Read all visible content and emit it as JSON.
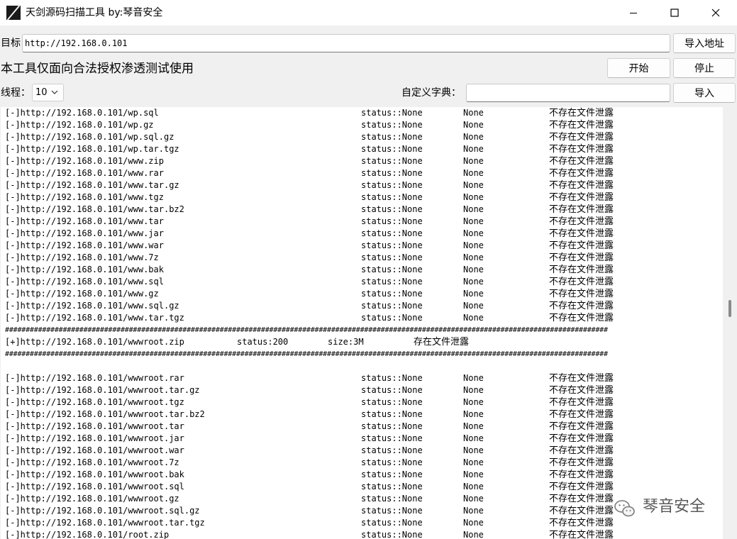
{
  "window": {
    "title": "天剑源码扫描工具 by:琴音安全"
  },
  "target": {
    "label": "目标",
    "value": "http://192.168.0.101",
    "import_button": "导入地址"
  },
  "notice": "本工具仅面向合法授权渗透测试使用",
  "controls": {
    "start_button": "开始",
    "stop_button": "停止",
    "threads_label": "线程：",
    "threads_value": "10",
    "dict_label": "自定义字典：",
    "dict_value": "",
    "dict_import_button": "导入"
  },
  "output": {
    "rows_before": [
      {
        "url": "[-]http://192.168.0.101/wp.sql",
        "status": "status::None",
        "size": "None",
        "msg": "不存在文件泄露"
      },
      {
        "url": "[-]http://192.168.0.101/wp.gz",
        "status": "status::None",
        "size": "None",
        "msg": "不存在文件泄露"
      },
      {
        "url": "[-]http://192.168.0.101/wp.sql.gz",
        "status": "status::None",
        "size": "None",
        "msg": "不存在文件泄露"
      },
      {
        "url": "[-]http://192.168.0.101/wp.tar.tgz",
        "status": "status::None",
        "size": "None",
        "msg": "不存在文件泄露"
      },
      {
        "url": "[-]http://192.168.0.101/www.zip",
        "status": "status::None",
        "size": "None",
        "msg": "不存在文件泄露"
      },
      {
        "url": "[-]http://192.168.0.101/www.rar",
        "status": "status::None",
        "size": "None",
        "msg": "不存在文件泄露"
      },
      {
        "url": "[-]http://192.168.0.101/www.tar.gz",
        "status": "status::None",
        "size": "None",
        "msg": "不存在文件泄露"
      },
      {
        "url": "[-]http://192.168.0.101/www.tgz",
        "status": "status::None",
        "size": "None",
        "msg": "不存在文件泄露"
      },
      {
        "url": "[-]http://192.168.0.101/www.tar.bz2",
        "status": "status::None",
        "size": "None",
        "msg": "不存在文件泄露"
      },
      {
        "url": "[-]http://192.168.0.101/www.tar",
        "status": "status::None",
        "size": "None",
        "msg": "不存在文件泄露"
      },
      {
        "url": "[-]http://192.168.0.101/www.jar",
        "status": "status::None",
        "size": "None",
        "msg": "不存在文件泄露"
      },
      {
        "url": "[-]http://192.168.0.101/www.war",
        "status": "status::None",
        "size": "None",
        "msg": "不存在文件泄露"
      },
      {
        "url": "[-]http://192.168.0.101/www.7z",
        "status": "status::None",
        "size": "None",
        "msg": "不存在文件泄露"
      },
      {
        "url": "[-]http://192.168.0.101/www.bak",
        "status": "status::None",
        "size": "None",
        "msg": "不存在文件泄露"
      },
      {
        "url": "[-]http://192.168.0.101/www.sql",
        "status": "status::None",
        "size": "None",
        "msg": "不存在文件泄露"
      },
      {
        "url": "[-]http://192.168.0.101/www.gz",
        "status": "status::None",
        "size": "None",
        "msg": "不存在文件泄露"
      },
      {
        "url": "[-]http://192.168.0.101/www.sql.gz",
        "status": "status::None",
        "size": "None",
        "msg": "不存在文件泄露"
      },
      {
        "url": "[-]http://192.168.0.101/www.tar.tgz",
        "status": "status::None",
        "size": "None",
        "msg": "不存在文件泄露"
      }
    ],
    "separator": "##################################################################################################################################################",
    "found": {
      "url": "[+]http://192.168.0.101/wwwroot.zip",
      "status": "status:200",
      "size": "size:3M",
      "msg": "存在文件泄露"
    },
    "rows_after": [
      {
        "url": "[-]http://192.168.0.101/wwwroot.rar",
        "status": "status::None",
        "size": "None",
        "msg": "不存在文件泄露"
      },
      {
        "url": "[-]http://192.168.0.101/wwwroot.tar.gz",
        "status": "status::None",
        "size": "None",
        "msg": "不存在文件泄露"
      },
      {
        "url": "[-]http://192.168.0.101/wwwroot.tgz",
        "status": "status::None",
        "size": "None",
        "msg": "不存在文件泄露"
      },
      {
        "url": "[-]http://192.168.0.101/wwwroot.tar.bz2",
        "status": "status::None",
        "size": "None",
        "msg": "不存在文件泄露"
      },
      {
        "url": "[-]http://192.168.0.101/wwwroot.tar",
        "status": "status::None",
        "size": "None",
        "msg": "不存在文件泄露"
      },
      {
        "url": "[-]http://192.168.0.101/wwwroot.jar",
        "status": "status::None",
        "size": "None",
        "msg": "不存在文件泄露"
      },
      {
        "url": "[-]http://192.168.0.101/wwwroot.war",
        "status": "status::None",
        "size": "None",
        "msg": "不存在文件泄露"
      },
      {
        "url": "[-]http://192.168.0.101/wwwroot.7z",
        "status": "status::None",
        "size": "None",
        "msg": "不存在文件泄露"
      },
      {
        "url": "[-]http://192.168.0.101/wwwroot.bak",
        "status": "status::None",
        "size": "None",
        "msg": "不存在文件泄露"
      },
      {
        "url": "[-]http://192.168.0.101/wwwroot.sql",
        "status": "status::None",
        "size": "None",
        "msg": "不存在文件泄露"
      },
      {
        "url": "[-]http://192.168.0.101/wwwroot.gz",
        "status": "status::None",
        "size": "None",
        "msg": "不存在文件泄露"
      },
      {
        "url": "[-]http://192.168.0.101/wwwroot.sql.gz",
        "status": "status::None",
        "size": "None",
        "msg": "不存在文件泄露"
      },
      {
        "url": "[-]http://192.168.0.101/wwwroot.tar.tgz",
        "status": "status::None",
        "size": "None",
        "msg": "不存在文件泄露"
      },
      {
        "url": "[-]http://192.168.0.101/root.zip",
        "status": "status::None",
        "size": "None",
        "msg": "不存在文件泄露"
      }
    ]
  },
  "watermark": {
    "text": "琴音安全",
    "icon": "wechat-icon"
  }
}
